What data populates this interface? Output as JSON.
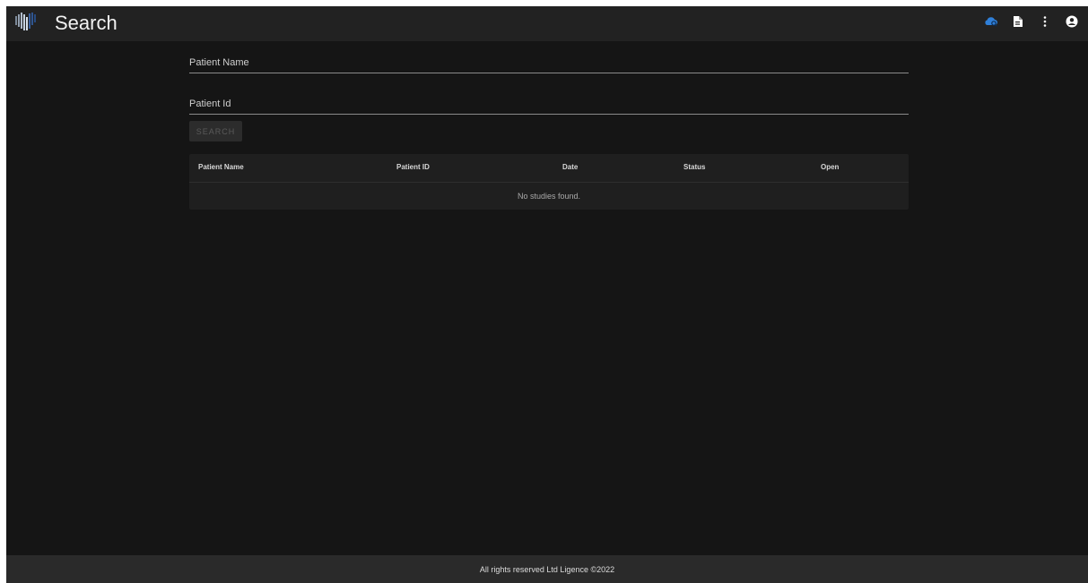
{
  "header": {
    "title": "Search",
    "actions": [
      {
        "icon": "cloud-search-icon",
        "color": "#2f7fd8"
      },
      {
        "icon": "file-icon",
        "color": "#ffffff"
      },
      {
        "icon": "more-vert-icon",
        "color": "#ffffff"
      },
      {
        "icon": "account-circle-icon",
        "color": "#ffffff"
      }
    ]
  },
  "form": {
    "patient_name_placeholder": "Patient Name",
    "patient_id_placeholder": "Patient Id",
    "search_label": "SEARCH"
  },
  "table": {
    "columns": [
      "Patient Name",
      "Patient ID",
      "Date",
      "Status",
      "Open"
    ],
    "empty_message": "No studies found."
  },
  "footer": {
    "text": "All rights reserved Ltd Ligence ©2022"
  },
  "colors": {
    "background": "#151515",
    "appbar": "#222222",
    "accent": "#2f7fd8"
  }
}
